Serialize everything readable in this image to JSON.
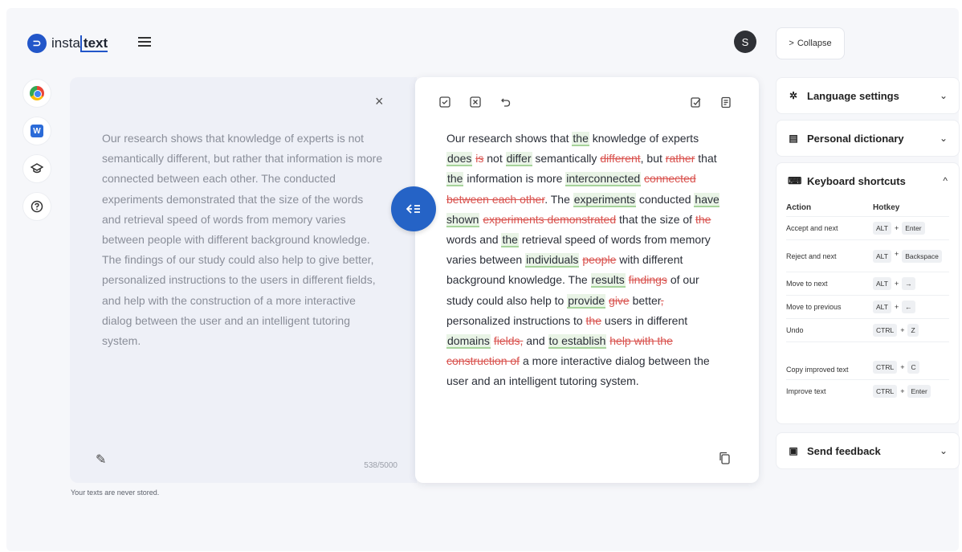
{
  "app": {
    "logo_mark": "⊃",
    "logo_part1": "insta",
    "logo_part2": "text"
  },
  "header": {
    "avatar_initial": "S",
    "collapse_label": "Collapse",
    "collapse_chevron": ">"
  },
  "input_panel": {
    "text": "Our research shows that knowledge of experts is not semantically different, but rather that information is more connected between each other. The conducted experiments demonstrated that the size of the words and retrieval speed of words from memory varies between people with different background knowledge. The findings of our study could also help to give better, personalized instructions to the users in different fields, and help with the construction of a more interactive dialog between the user and an intelligent tutoring system.",
    "char_count": "538/5000",
    "close_glyph": "×",
    "privacy_note": "Your texts are never stored."
  },
  "output_panel": {
    "segments": [
      {
        "t": "Our research shows that ",
        "s": "n"
      },
      {
        "t": "the",
        "s": "a"
      },
      {
        "t": " knowledge of experts ",
        "s": "n"
      },
      {
        "t": "does",
        "s": "a"
      },
      {
        "t": " ",
        "s": "n"
      },
      {
        "t": "is",
        "s": "d"
      },
      {
        "t": " not ",
        "s": "n"
      },
      {
        "t": "differ",
        "s": "a"
      },
      {
        "t": " semantically ",
        "s": "n"
      },
      {
        "t": "different",
        "s": "d"
      },
      {
        "t": ", but ",
        "s": "n"
      },
      {
        "t": "rather",
        "s": "d"
      },
      {
        "t": " that ",
        "s": "n"
      },
      {
        "t": "the",
        "s": "a"
      },
      {
        "t": " information is more ",
        "s": "n"
      },
      {
        "t": "interconnected",
        "s": "a"
      },
      {
        "t": " ",
        "s": "n"
      },
      {
        "t": "connected between each other",
        "s": "d"
      },
      {
        "t": ". The ",
        "s": "n"
      },
      {
        "t": "experiments",
        "s": "a"
      },
      {
        "t": " conducted ",
        "s": "n"
      },
      {
        "t": "have shown",
        "s": "a"
      },
      {
        "t": " ",
        "s": "n"
      },
      {
        "t": "experiments demonstrated",
        "s": "d"
      },
      {
        "t": " that the size of ",
        "s": "n"
      },
      {
        "t": "the",
        "s": "d"
      },
      {
        "t": " words and ",
        "s": "n"
      },
      {
        "t": "the",
        "s": "a"
      },
      {
        "t": " retrieval speed of words from memory varies between ",
        "s": "n"
      },
      {
        "t": "individuals",
        "s": "a"
      },
      {
        "t": " ",
        "s": "n"
      },
      {
        "t": "people",
        "s": "d"
      },
      {
        "t": " with different background knowledge. The ",
        "s": "n"
      },
      {
        "t": "results",
        "s": "a"
      },
      {
        "t": " ",
        "s": "n"
      },
      {
        "t": "findings",
        "s": "d"
      },
      {
        "t": " of our study could also help to ",
        "s": "n"
      },
      {
        "t": "provide",
        "s": "a"
      },
      {
        "t": " ",
        "s": "n"
      },
      {
        "t": "give",
        "s": "d"
      },
      {
        "t": " better",
        "s": "n"
      },
      {
        "t": ",",
        "s": "d"
      },
      {
        "t": " personalized instructions to ",
        "s": "n"
      },
      {
        "t": "the",
        "s": "d"
      },
      {
        "t": " users in different ",
        "s": "n"
      },
      {
        "t": "domains",
        "s": "a"
      },
      {
        "t": " ",
        "s": "n"
      },
      {
        "t": "fields,",
        "s": "d"
      },
      {
        "t": " and ",
        "s": "n"
      },
      {
        "t": "to establish",
        "s": "a"
      },
      {
        "t": " ",
        "s": "n"
      },
      {
        "t": "help with the construction of",
        "s": "d"
      },
      {
        "t": " a more interactive dialog between the user and an intelligent tutoring system.",
        "s": "n"
      }
    ]
  },
  "sidebar": {
    "language_settings": "Language settings",
    "personal_dictionary": "Personal dictionary",
    "keyboard_shortcuts": "Keyboard shortcuts",
    "send_feedback": "Send feedback",
    "chevron_down": "⌄",
    "chevron_up": "^",
    "table_headers": {
      "action": "Action",
      "hotkey": "Hotkey"
    },
    "shortcuts": [
      {
        "action": "Accept and next",
        "keys": [
          "ALT",
          "Enter"
        ]
      },
      {
        "action": "Reject and next",
        "keys": [
          "ALT",
          "Backspace"
        ]
      },
      {
        "action": "Move to next",
        "keys": [
          "ALT",
          "→"
        ]
      },
      {
        "action": "Move to previous",
        "keys": [
          "ALT",
          "←"
        ]
      },
      {
        "action": "Undo",
        "keys": [
          "CTRL",
          "Z"
        ]
      },
      {
        "action": "Copy improved text",
        "keys": [
          "CTRL",
          "C"
        ]
      },
      {
        "action": "Improve text",
        "keys": [
          "CTRL",
          "Enter"
        ]
      }
    ]
  }
}
